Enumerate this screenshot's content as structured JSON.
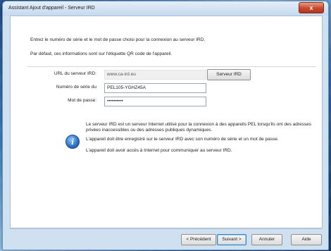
{
  "window": {
    "title": "Assistant Ajout d'appareil - Serveur IRD",
    "close_label": "x"
  },
  "intro": {
    "line1": "Entrez le numéro de série et le mot de passe choisi pour la connexion au serveur IRD.",
    "line2": "Par défaut, ces informations sont sur l'étiquette QR code de l'appareil."
  },
  "form": {
    "url_label": "URL du serveur IRD:",
    "url_value": "www.ca-ird.eu",
    "server_button": "Serveur IRD",
    "serial_label": "Numéro de série du",
    "serial_value": "PEL105-YGHZ45A",
    "password_label": "Mot de passe:",
    "password_value": "••••••••••"
  },
  "info": {
    "icon": "info-icon",
    "para1": "Le serveur IRD est un serveur Internet utilisé pour la connexion à des appareils PEL lorsqu'ils ont des adresses privées inaccessibles ou des adresses publiques dynamiques.",
    "para2": "L'appareil doit être enregistré sur le serveur IRD avec son numéro de série et un mot de passe.",
    "para3": "L'appareil doit avoir accès à Internet pour communiquer au serveur IRD."
  },
  "footer": {
    "prev_label": "< Précédent",
    "next_label": "Suivant >",
    "cancel_label": "Annuler",
    "help_label": "Aide"
  }
}
